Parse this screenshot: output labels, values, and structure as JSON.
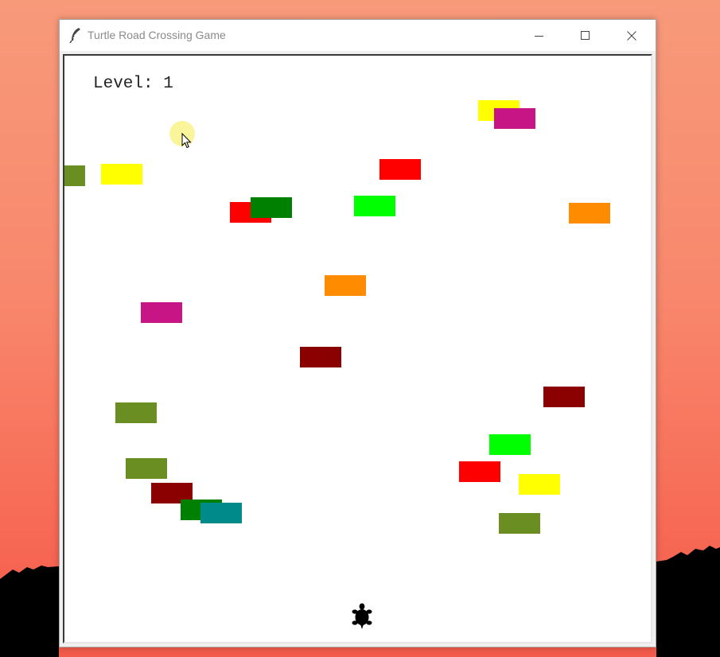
{
  "window": {
    "title": "Turtle Road Crossing Game"
  },
  "hud": {
    "level_text": "Level: 1"
  },
  "colors": {
    "yellow": "#ffff00",
    "magenta": "#c71585",
    "red": "#ff0000",
    "green": "#008000",
    "lime": "#00ff00",
    "orange": "#ff8c00",
    "olive": "#6b8e23",
    "darkred": "#8b0000",
    "teal": "#008b8b",
    "turtle": "#000000"
  },
  "cars": [
    {
      "color": "olive"
    },
    {
      "color": "yellow"
    },
    {
      "color": "yellow"
    },
    {
      "color": "magenta"
    },
    {
      "color": "red"
    },
    {
      "color": "red"
    },
    {
      "color": "green"
    },
    {
      "color": "lime"
    },
    {
      "color": "orange"
    },
    {
      "color": "orange"
    },
    {
      "color": "magenta"
    },
    {
      "color": "darkred"
    },
    {
      "color": "darkred"
    },
    {
      "color": "olive"
    },
    {
      "color": "lime"
    },
    {
      "color": "red"
    },
    {
      "color": "yellow"
    },
    {
      "color": "olive"
    },
    {
      "color": "darkred"
    },
    {
      "color": "green"
    },
    {
      "color": "teal"
    },
    {
      "color": "olive"
    }
  ],
  "icons": {
    "app": "feather-icon",
    "minimize": "minimize-icon",
    "maximize": "maximize-icon",
    "close": "close-icon",
    "player": "turtle-icon",
    "pointer": "mouse-cursor-icon"
  }
}
